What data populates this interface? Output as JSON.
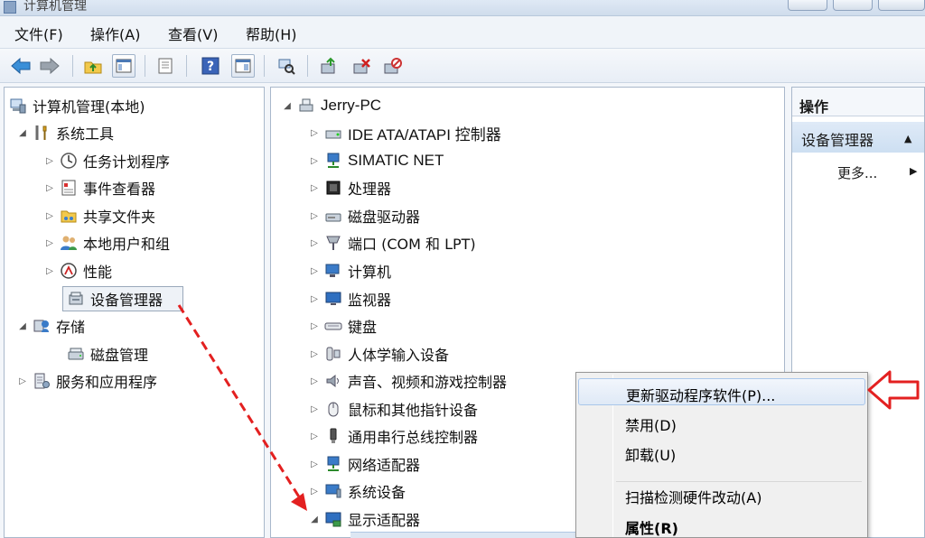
{
  "window": {
    "title": "计算机管理"
  },
  "menu": [
    {
      "id": "file",
      "label": "文件(F)"
    },
    {
      "id": "action",
      "label": "操作(A)"
    },
    {
      "id": "view",
      "label": "查看(V)"
    },
    {
      "id": "help",
      "label": "帮助(H)"
    }
  ],
  "toolbar_icons": [
    "back-arrow-icon",
    "forward-arrow-icon",
    "up-folder-icon",
    "show-tree-icon",
    "export-list-icon",
    "help-icon",
    "properties-icon",
    "scan-hardware-icon",
    "update-driver-icon",
    "uninstall-icon",
    "disable-icon"
  ],
  "left_tree": {
    "root": "计算机管理(本地)",
    "system_tools": "系统工具",
    "task_scheduler": "任务计划程序",
    "event_viewer": "事件查看器",
    "shared_folders": "共享文件夹",
    "local_users": "本地用户和组",
    "performance": "性能",
    "device_manager": "设备管理器",
    "storage": "存储",
    "disk_management": "磁盘管理",
    "services_apps": "服务和应用程序"
  },
  "device_tree": {
    "root": "Jerry-PC",
    "categories": [
      "IDE ATA/ATAPI 控制器",
      "SIMATIC NET",
      "处理器",
      "磁盘驱动器",
      "端口 (COM 和 LPT)",
      "计算机",
      "监视器",
      "键盘",
      "人体学输入设备",
      "声音、视频和游戏控制器",
      "鼠标和其他指针设备",
      "通用串行总线控制器",
      "网络适配器",
      "系统设备",
      "显示适配器"
    ]
  },
  "actions": {
    "header": "操作",
    "section": "设备管理器",
    "more": "更多..."
  },
  "context_menu": {
    "update_driver": "更新驱动程序软件(P)...",
    "disable": "禁用(D)",
    "uninstall": "卸载(U)",
    "scan": "扫描检测硬件改动(A)",
    "properties": "属性(R)"
  },
  "colors": {
    "annotation_red": "#e32020",
    "selection_bg": "#eef2f7",
    "menu_highlight": "#dfe9f6"
  }
}
